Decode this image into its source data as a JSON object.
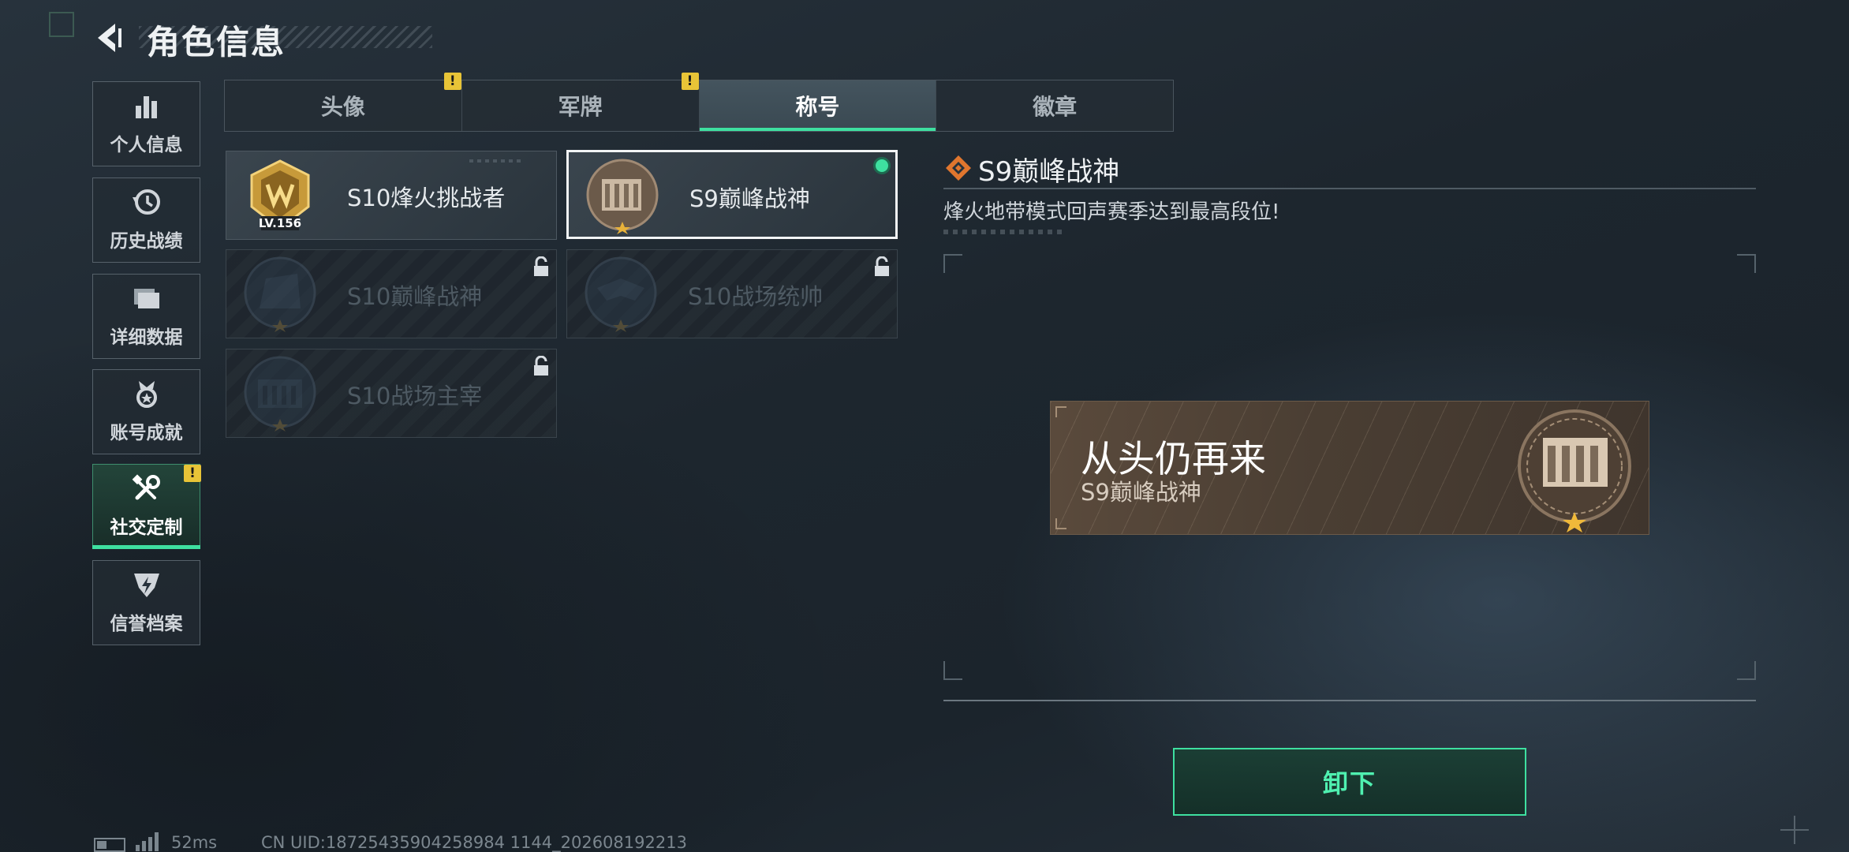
{
  "header": {
    "title": "角色信息"
  },
  "sidebar": {
    "items": [
      {
        "label": "个人信息",
        "icon": "bar-chart-icon"
      },
      {
        "label": "历史战绩",
        "icon": "history-icon"
      },
      {
        "label": "详细数据",
        "icon": "folder-icon"
      },
      {
        "label": "账号成就",
        "icon": "medal-icon"
      },
      {
        "label": "社交定制",
        "icon": "tools-icon",
        "active": true,
        "alert": "!"
      },
      {
        "label": "信誉档案",
        "icon": "shield-bolt-icon"
      }
    ]
  },
  "tabs": [
    {
      "label": "头像",
      "alert": "!"
    },
    {
      "label": "军牌",
      "alert": "!"
    },
    {
      "label": "称号",
      "active": true
    },
    {
      "label": "徽章"
    }
  ],
  "titles": [
    {
      "name": "S10烽火挑战者",
      "emblem_text": "LV.156",
      "locked": false
    },
    {
      "name": "S9巅峰战神",
      "locked": false,
      "selected": true,
      "equipped": true
    },
    {
      "name": "S10巅峰战神",
      "locked": true
    },
    {
      "name": "S10战场统帅",
      "locked": true
    },
    {
      "name": "S10战场主宰",
      "locked": true
    }
  ],
  "detail": {
    "title": "S9巅峰战神",
    "description": "烽火地带模式回声赛季达到最高段位!",
    "nameplate": {
      "main": "从头仍再来",
      "sub": "S9巅峰战神"
    },
    "action_label": "卸下"
  },
  "status": {
    "ping": "52ms",
    "uid": "CN UID:18725435904258984 1144_202608192213"
  },
  "colors": {
    "accent": "#3ee0a0",
    "alert": "#e8c437",
    "nameplate": "#4a3e33"
  }
}
